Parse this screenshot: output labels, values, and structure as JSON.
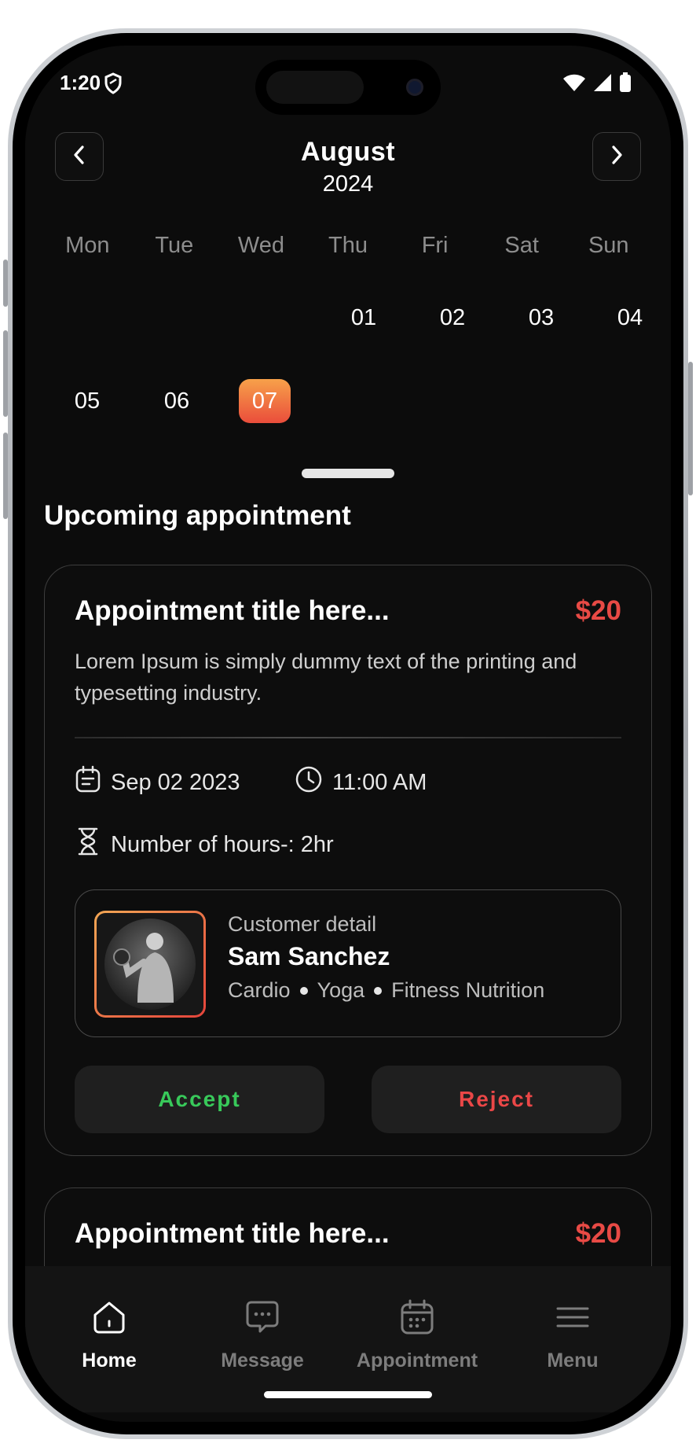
{
  "status_bar": {
    "time": "1:20"
  },
  "calendar": {
    "month": "August",
    "year": "2024",
    "weekdays": [
      "Mon",
      "Tue",
      "Wed",
      "Thu",
      "Fri",
      "Sat",
      "Sun"
    ],
    "days": [
      "01",
      "02",
      "03",
      "04",
      "05",
      "06",
      "07"
    ],
    "selected_day": "07",
    "accent_gradient": [
      "#f7a14a",
      "#ea4d3b"
    ]
  },
  "section_title": "Upcoming appointment",
  "appointments": [
    {
      "title": "Appointment title here...",
      "price": "$20",
      "description": "Lorem Ipsum is simply dummy text of the printing and typesetting industry.",
      "date": "Sep 02 2023",
      "time": "11:00 AM",
      "hours": "Number of hours-: 2hr",
      "customer_label": "Customer detail",
      "customer_name": "Sam Sanchez",
      "tags": [
        "Cardio",
        "Yoga",
        "Fitness Nutrition"
      ],
      "accept_label": "Accept",
      "reject_label": "Reject"
    },
    {
      "title": "Appointment title here...",
      "price": "$20"
    }
  ],
  "bottom_nav": [
    {
      "label": "Home",
      "icon": "home-icon",
      "active": true
    },
    {
      "label": "Message",
      "icon": "message-icon",
      "active": false
    },
    {
      "label": "Appointment",
      "icon": "calendar-icon",
      "active": false
    },
    {
      "label": "Menu",
      "icon": "menu-icon",
      "active": false
    }
  ],
  "colors": {
    "price": "#e84a45",
    "accept": "#38c95a",
    "reject": "#ea4747",
    "background": "#0c0c0c"
  }
}
